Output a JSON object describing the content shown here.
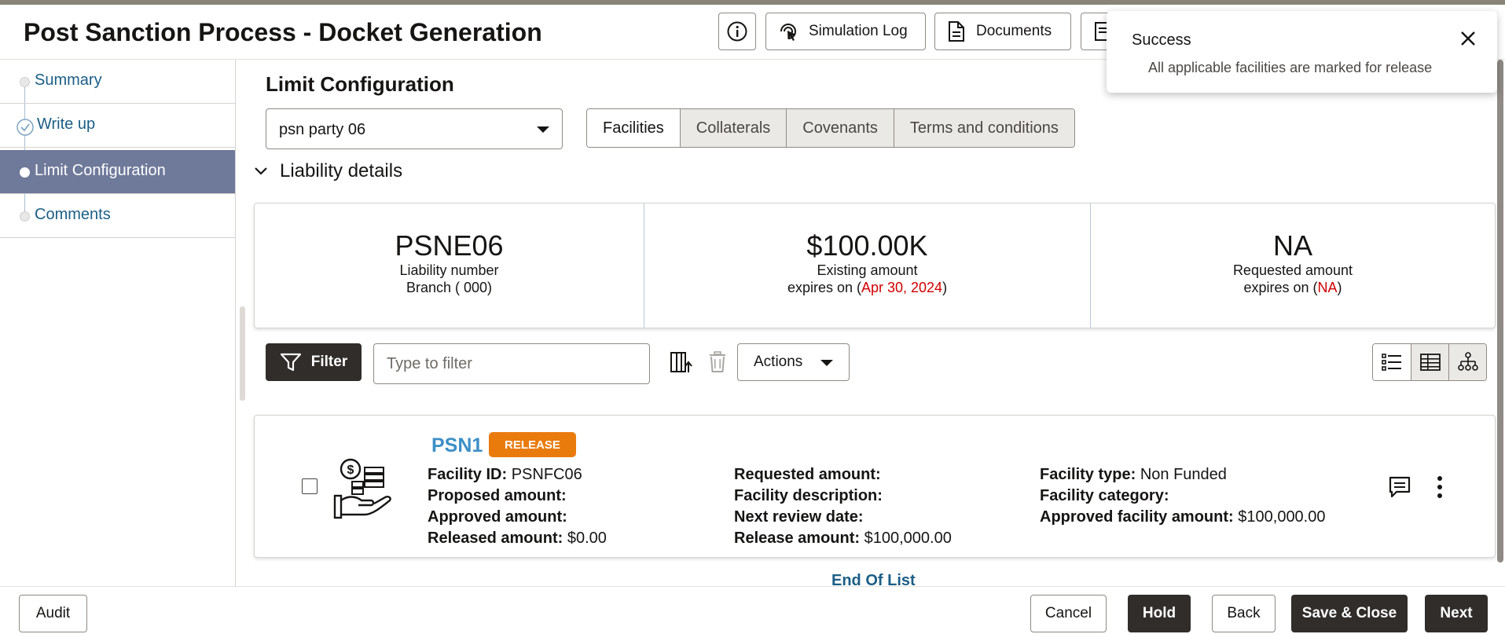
{
  "header": {
    "title": "Post Sanction Process - Docket Generation",
    "buttons": {
      "simulation_log": "Simulation Log",
      "documents": "Documents"
    }
  },
  "sidebar": {
    "items": [
      {
        "label": "Summary"
      },
      {
        "label": "Write up"
      },
      {
        "label": "Limit Configuration"
      },
      {
        "label": "Comments"
      }
    ]
  },
  "main": {
    "section_title": "Limit Configuration",
    "party_select": {
      "value": "psn party 06"
    },
    "tabs": [
      "Facilities",
      "Collaterals",
      "Covenants",
      "Terms and conditions"
    ],
    "liability_toggle": "Liability details",
    "liability_cards": [
      {
        "big": "PSNE06",
        "line1": "Liability number",
        "line2": "Branch ( 000)"
      },
      {
        "big": "$100.00K",
        "line1": "Existing amount",
        "line2_prefix": "expires on (",
        "line2_value": "Apr 30, 2024",
        "line2_suffix": ")"
      },
      {
        "big": "NA",
        "line1": "Requested amount",
        "line2_prefix": "expires on (",
        "line2_value": "NA",
        "line2_suffix": ")"
      }
    ],
    "filter": {
      "label": "Filter",
      "placeholder": "Type to filter"
    },
    "actions_label": "Actions",
    "facility": {
      "name": "PSN1",
      "badge": "RELEASE",
      "col1": [
        {
          "k": "Facility ID:",
          "v": "PSNFC06"
        },
        {
          "k": "Proposed amount:",
          "v": ""
        },
        {
          "k": "Approved amount:",
          "v": ""
        },
        {
          "k": "Released amount:",
          "v": "$0.00"
        }
      ],
      "col2": [
        {
          "k": "Requested amount:",
          "v": ""
        },
        {
          "k": "Facility description:",
          "v": ""
        },
        {
          "k": "Next review date:",
          "v": ""
        },
        {
          "k": "Release amount:",
          "v": "$100,000.00"
        }
      ],
      "col3": [
        {
          "k": "Facility type:",
          "v": "Non Funded"
        },
        {
          "k": "Facility category:",
          "v": ""
        },
        {
          "k": "Approved facility amount:",
          "v": "$100,000.00"
        }
      ]
    },
    "end_of_list": "End Of List"
  },
  "footer": {
    "audit": "Audit",
    "cancel": "Cancel",
    "hold": "Hold",
    "back": "Back",
    "save_close": "Save & Close",
    "next": "Next"
  },
  "toast": {
    "title": "Success",
    "message": "All applicable facilities are marked for release"
  },
  "colors": {
    "accent_dark": "#312d2a",
    "link": "#1b5e86",
    "active_step": "#6f7a9b",
    "badge": "#e97b0d",
    "error": "#d00000"
  }
}
